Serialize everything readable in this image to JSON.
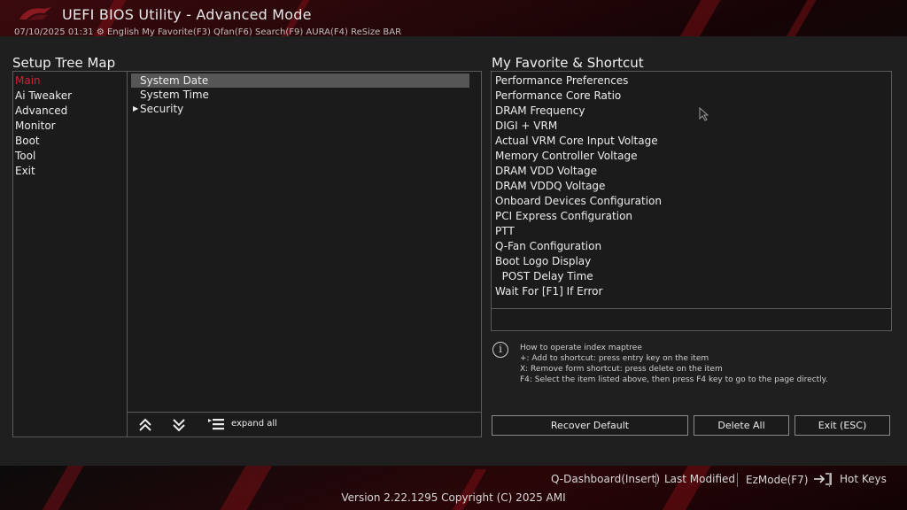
{
  "window": {
    "title": "UEFI BIOS Utility - Advanced Mode",
    "top_strip": "07/10/2025  01:31    ⚙  English   My Favorite(F3)   Qfan(F6)   Search(F9)   AURA(F4)   ReSize BAR"
  },
  "tree_map": {
    "title": "Setup Tree Map",
    "left_items": [
      {
        "label": "Main",
        "active": true
      },
      {
        "label": "Ai Tweaker",
        "active": false
      },
      {
        "label": "Advanced",
        "active": false
      },
      {
        "label": "Monitor",
        "active": false
      },
      {
        "label": "Boot",
        "active": false
      },
      {
        "label": "Tool",
        "active": false
      },
      {
        "label": "Exit",
        "active": false
      }
    ],
    "right_items": [
      {
        "label": "System Date",
        "selected": true,
        "expandable": false
      },
      {
        "label": "System Time",
        "selected": false,
        "expandable": false
      },
      {
        "label": "Security",
        "selected": false,
        "expandable": true
      }
    ],
    "expand_all_label": "expand all"
  },
  "favorites": {
    "title": "My Favorite & Shortcut",
    "items": [
      "Performance Preferences",
      "Performance Core Ratio",
      "DRAM Frequency",
      "DIGI + VRM",
      "Actual VRM Core Input Voltage",
      "Memory Controller Voltage",
      "DRAM VDD Voltage",
      "DRAM VDDQ Voltage",
      "Onboard Devices Configuration",
      "PCI Express Configuration",
      "PTT",
      "Q-Fan Configuration",
      "Boot Logo Display",
      "  POST Delay Time",
      "Wait For [F1] If Error"
    ]
  },
  "info": {
    "lines": [
      "How to operate index maptree",
      "+: Add to shortcut: press entry key on the item",
      "X: Remove form shortcut: press delete on the item",
      "F4: Select the item listed above, then press F4 key to go to the page directly."
    ]
  },
  "buttons": {
    "recover_default": "Recover Default",
    "delete_all": "Delete All",
    "exit": "Exit (ESC)"
  },
  "footer": {
    "q_dashboard": "Q-Dashboard(Insert)",
    "last_modified": "Last Modified",
    "ez_mode": "EzMode(F7)",
    "hot_keys": "Hot Keys",
    "version": "Version 2.22.1295 Copyright (C) 2025 AMI"
  },
  "colors": {
    "accent_red": "#d2202e",
    "panel_bg": "#1b1b1b",
    "selected_bg": "#565656"
  }
}
